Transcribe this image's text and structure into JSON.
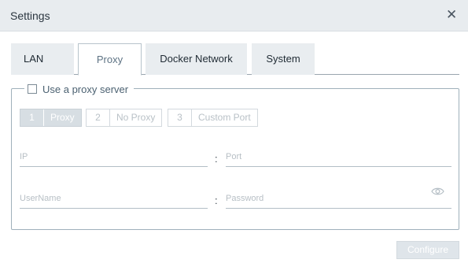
{
  "dialog": {
    "title": "Settings",
    "close_icon": "close-icon"
  },
  "tabs": [
    {
      "label": "LAN",
      "active": false
    },
    {
      "label": "Proxy",
      "active": true
    },
    {
      "label": "Docker Network",
      "active": false
    },
    {
      "label": "System",
      "active": false
    }
  ],
  "proxy": {
    "use_proxy_label": "Use a proxy server",
    "use_proxy_checked": false,
    "steps": [
      {
        "number": "1",
        "label": "Proxy",
        "active": true
      },
      {
        "number": "2",
        "label": "No Proxy",
        "active": false
      },
      {
        "number": "3",
        "label": "Custom Port",
        "active": false
      }
    ],
    "ip_placeholder": "IP",
    "port_placeholder": "Port",
    "username_placeholder": "UserName",
    "password_placeholder": "Password",
    "separator": ":",
    "password_visibility_icon": "eye-icon"
  },
  "footer": {
    "configure_label": "Configure",
    "configure_enabled": false
  },
  "colors": {
    "titlebar_bg": "#e8ecef",
    "active_tab_text": "#5e7384",
    "disabled_button_bg": "#dfe5ea"
  }
}
